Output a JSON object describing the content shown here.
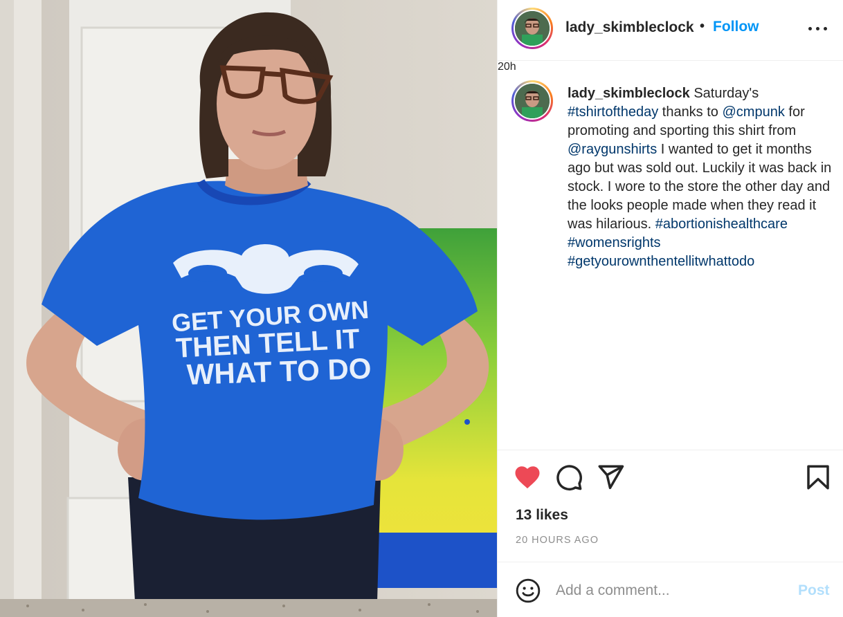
{
  "post": {
    "author": "lady_skimbleclock",
    "separator": "•",
    "follow_label": "Follow",
    "more_icon": "more-horizontal-icon",
    "photo_description_icon": "photo",
    "caption": {
      "author": "lady_skimbleclock",
      "text_1": " Saturday's ",
      "tag_1": "#tshirtoftheday",
      "text_2": " thanks to ",
      "tag_2": "@cmpunk",
      "text_3": " for promoting and sporting this shirt from ",
      "tag_3": "@raygunshirts",
      "text_4": " I wanted to get it months ago but was sold out. Luckily it was back in stock. I wore to the store the other day and the looks people made when they read it was hilarious. ",
      "tag_4": "#abortionishealthcare",
      "text_5": " ",
      "tag_5": "#womensrights",
      "text_6": " ",
      "tag_6": "#getyourownthentellitwhattodo",
      "relative_time": "20h"
    },
    "shirt_text": {
      "line_1": "GET YOUR OWN",
      "line_2": "THEN TELL IT",
      "line_3": "WHAT TO DO"
    },
    "likes": "13 likes",
    "timestamp": "20 HOURS AGO",
    "liked": true
  },
  "comment": {
    "placeholder": "Add a comment...",
    "post_label": "Post"
  },
  "icons": {
    "like": "heart-icon",
    "comment": "comment-icon",
    "share": "send-icon",
    "save": "bookmark-icon",
    "emoji": "emoji-icon"
  },
  "colors": {
    "follow": "#0095f6",
    "hashtag": "#00376b",
    "heart": "#ed4956",
    "post_disabled": "#b2dffc",
    "secondary_text": "#8e8e8e"
  }
}
